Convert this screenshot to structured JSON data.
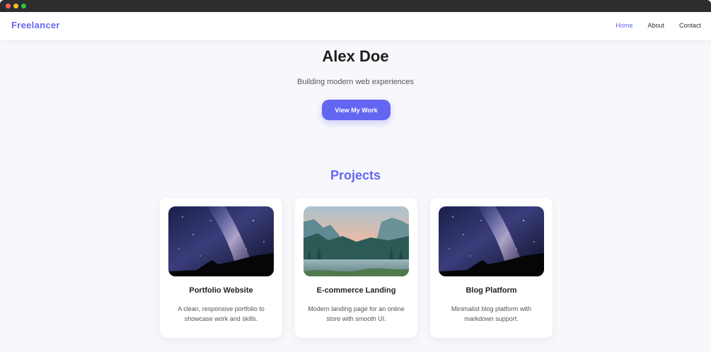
{
  "nav": {
    "brand": "Freelancer",
    "links": [
      "Home",
      "About",
      "Contact"
    ],
    "active": "Home"
  },
  "hero": {
    "name": "Alex Doe",
    "tagline": "Building modern web experiences",
    "cta_label": "View My Work"
  },
  "projects": {
    "title": "Projects",
    "items": [
      {
        "title": "Portfolio Website",
        "description": "A clean, responsive portfolio to showcase work and skills.",
        "image": "night-sky-milky-way"
      },
      {
        "title": "E-commerce Landing",
        "description": "Modern landing page for an online store with smooth UI.",
        "image": "mountain-valley-river"
      },
      {
        "title": "Blog Platform",
        "description": "Minimalist blog platform with markdown support.",
        "image": "night-sky-milky-way"
      }
    ]
  },
  "colors": {
    "accent": "#6366f1",
    "background": "#f8f8fc",
    "titlebar": "#2d2d30"
  }
}
